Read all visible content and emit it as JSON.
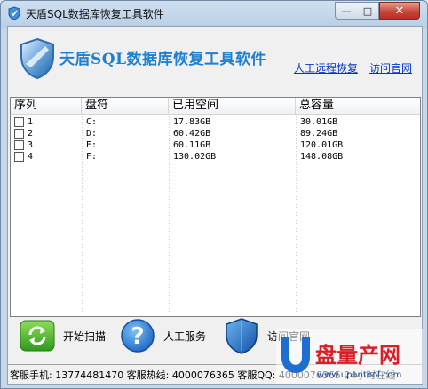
{
  "window": {
    "title": "天盾SQL数据库恢复工具软件",
    "min_symbol": "—",
    "max_symbol": "□",
    "close_symbol": "✕"
  },
  "header": {
    "app_name": "天盾SQL数据库恢复工具软件",
    "link_remote": "人工远程恢复",
    "link_site": "访问官网"
  },
  "table": {
    "columns": [
      "序列",
      "盘符",
      "已用空间",
      "总容量"
    ],
    "rows": [
      {
        "index": "1",
        "drive": "C:",
        "used": "17.83GB",
        "total": "30.01GB"
      },
      {
        "index": "2",
        "drive": "D:",
        "used": "60.42GB",
        "total": "89.24GB"
      },
      {
        "index": "3",
        "drive": "E:",
        "used": "60.11GB",
        "total": "120.01GB"
      },
      {
        "index": "4",
        "drive": "F:",
        "used": "130.02GB",
        "total": "148.08GB"
      }
    ]
  },
  "buttons": {
    "scan": "开始扫描",
    "service": "人工服务",
    "site": "访问官网"
  },
  "status": {
    "text": "客服手机: 13774481470 客服热线: 4000076365 客服QQ: 4000076365 24小时在线"
  },
  "watermark": {
    "brand": "盘量产网",
    "url": "www.upantool.com"
  },
  "colors": {
    "heading": "#1f7fd0",
    "link": "#0033cc",
    "close": "#c8473a"
  }
}
